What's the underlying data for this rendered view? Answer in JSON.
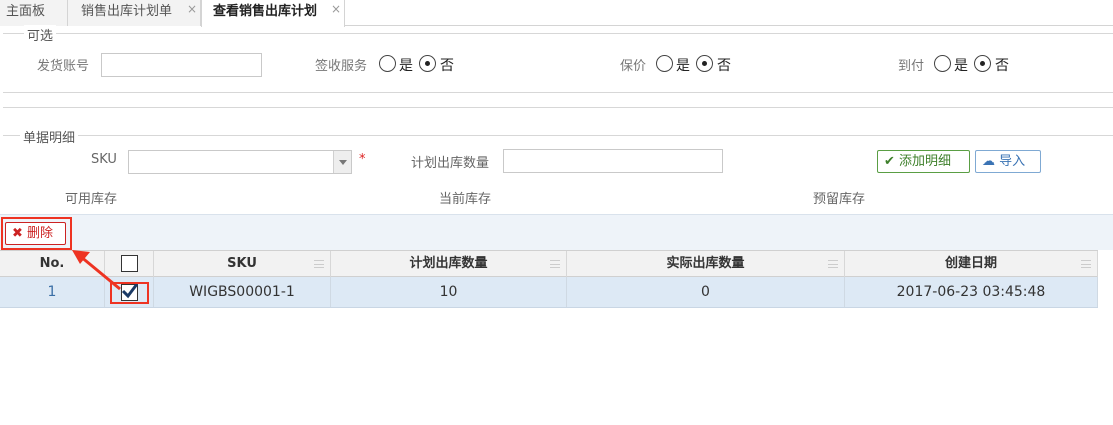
{
  "tabs": [
    {
      "label": "主面板"
    },
    {
      "label": "销售出库计划单",
      "close": "×"
    },
    {
      "label": "查看销售出库计划",
      "close": "×"
    }
  ],
  "optional_section": {
    "legend": "可选",
    "shipping_account_label": "发货账号",
    "shipping_account_value": "",
    "signing_service_label": "签收服务",
    "insured_label": "保价",
    "cod_label": "到付",
    "yes_label": "是",
    "no_label": "否",
    "signing_service_selected": "否",
    "insured_selected": "否",
    "cod_selected": "否"
  },
  "detail_section": {
    "legend": "单据明细",
    "sku_label": "SKU",
    "sku_value": "",
    "required_mark": "*",
    "planned_qty_label": "计划出库数量",
    "planned_qty_value": "",
    "add_detail_button": "添加明细",
    "import_button": "导入",
    "available_stock_label": "可用库存",
    "current_stock_label": "当前库存",
    "reserved_stock_label": "预留库存"
  },
  "toolbar": {
    "delete_button": "删除"
  },
  "table": {
    "columns": [
      "No.",
      "",
      "SKU",
      "计划出库数量",
      "实际出库数量",
      "创建日期"
    ],
    "rows": [
      {
        "no": "1",
        "checked": true,
        "sku": "WIGBS00001-1",
        "planned_qty": "10",
        "actual_qty": "0",
        "created": "2017-06-23 03:45:48"
      }
    ]
  },
  "colors": {
    "accent_red": "#e32222",
    "row_selected": "#dde9f5",
    "add_button_green": "#3d7f2a",
    "import_button_blue": "#3a73b4"
  },
  "icons": [
    "close-icon",
    "check-icon",
    "cloud-upload-icon",
    "delete-x-icon",
    "arrow-annotation-icon"
  ]
}
